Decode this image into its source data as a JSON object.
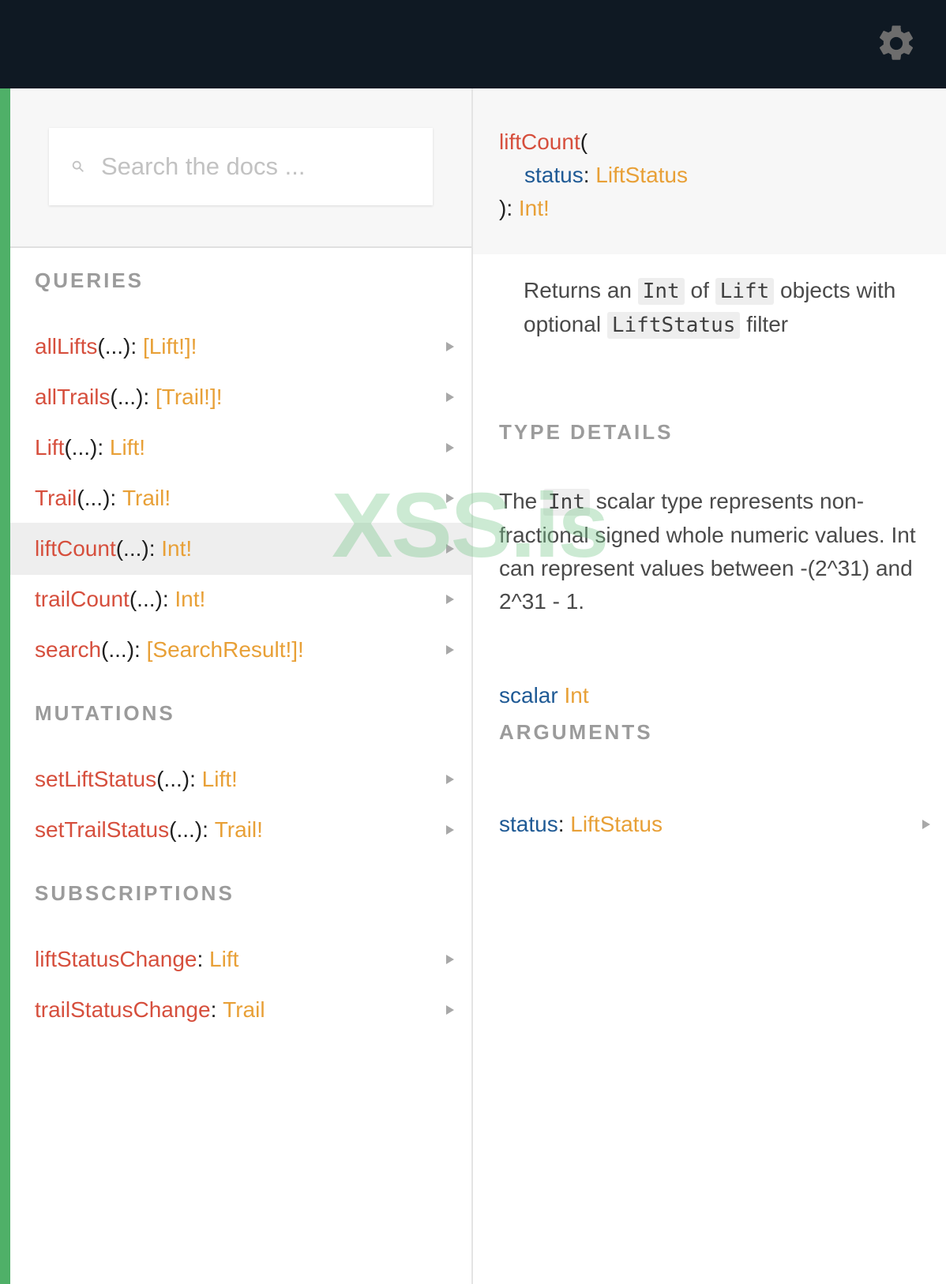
{
  "search": {
    "placeholder": "Search the docs ..."
  },
  "sections": {
    "queries": "QUERIES",
    "mutations": "MUTATIONS",
    "subscriptions": "SUBSCRIPTIONS"
  },
  "queries": [
    {
      "name": "allLifts",
      "args": "(...)",
      "sep": ": ",
      "type": "[Lift!]!"
    },
    {
      "name": "allTrails",
      "args": "(...)",
      "sep": ": ",
      "type": "[Trail!]!"
    },
    {
      "name": "Lift",
      "args": "(...)",
      "sep": ": ",
      "type": "Lift!"
    },
    {
      "name": "Trail",
      "args": "(...)",
      "sep": ": ",
      "type": "Trail!"
    },
    {
      "name": "liftCount",
      "args": "(...)",
      "sep": ": ",
      "type": "Int!"
    },
    {
      "name": "trailCount",
      "args": "(...)",
      "sep": ": ",
      "type": "Int!"
    },
    {
      "name": "search",
      "args": "(...)",
      "sep": ": ",
      "type": "[SearchResult!]!"
    }
  ],
  "mutations": [
    {
      "name": "setLiftStatus",
      "args": "(...)",
      "sep": ": ",
      "type": "Lift!"
    },
    {
      "name": "setTrailStatus",
      "args": "(...)",
      "sep": ": ",
      "type": "Trail!"
    }
  ],
  "subscriptions": [
    {
      "name": "liftStatusChange",
      "sep": ": ",
      "type": "Lift"
    },
    {
      "name": "trailStatusChange",
      "sep": ": ",
      "type": "Trail"
    }
  ],
  "detail": {
    "signature": {
      "name": "liftCount",
      "open": "(",
      "arg_name": "status",
      "arg_sep": ": ",
      "arg_type": "LiftStatus",
      "close": "): ",
      "return_type": "Int!"
    },
    "description": {
      "p1": "Returns an ",
      "c1": "Int",
      "p2": " of ",
      "c2": "Lift",
      "p3": " objects with optional ",
      "c3": "LiftStatus",
      "p4": " filter"
    },
    "type_details_title": "TYPE DETAILS",
    "type_description": {
      "p1": "The ",
      "c1": "Int",
      "p2": " scalar type represents non-fractional signed whole numeric values. Int can represent values between -(2^31) and 2^31 - 1."
    },
    "scalar": {
      "keyword": "scalar",
      "type": "Int"
    },
    "arguments_title": "ARGUMENTS",
    "argument": {
      "name": "status",
      "sep": ": ",
      "type": "LiftStatus"
    }
  },
  "watermark": "XSS.is",
  "colors": {
    "topbar": "#0f1923",
    "field_name": "#d64f3d",
    "type": "#e8a037",
    "arg_name": "#1f5a95",
    "green_strip": "#4fb068"
  },
  "icons": {
    "settings": "gear-icon",
    "search": "search-icon",
    "row_expand": "chevron-right-icon"
  }
}
